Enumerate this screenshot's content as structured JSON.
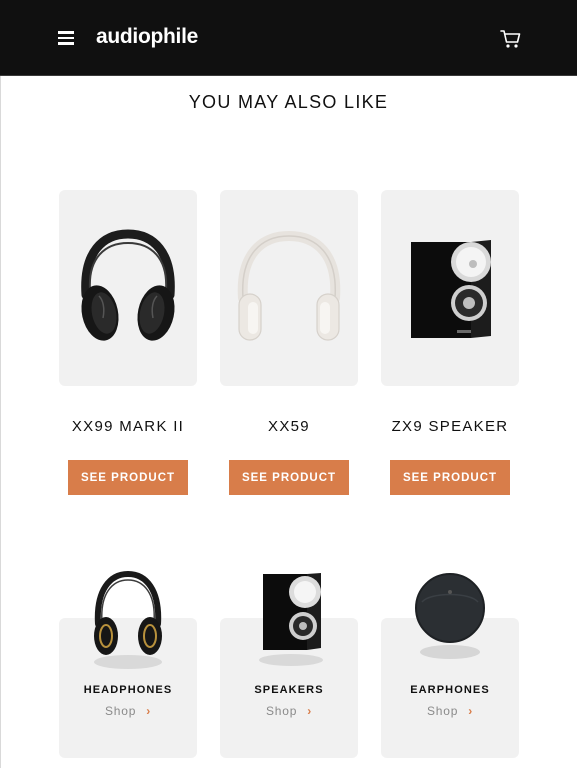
{
  "header": {
    "logo": "audiophile",
    "menu_icon": "hamburger-menu-icon",
    "cart_icon": "cart-icon"
  },
  "section_title": "YOU MAY ALSO LIKE",
  "recommendations": [
    {
      "name": "XX99 MARK II",
      "button": "SEE PRODUCT",
      "icon": "black-headphones-image"
    },
    {
      "name": "XX59",
      "button": "SEE PRODUCT",
      "icon": "white-headphones-image"
    },
    {
      "name": "ZX9 SPEAKER",
      "button": "SEE PRODUCT",
      "icon": "speaker-image"
    }
  ],
  "categories": [
    {
      "name": "HEADPHONES",
      "link": "Shop",
      "arrow": "›",
      "icon": "headphones-image"
    },
    {
      "name": "SPEAKERS",
      "link": "Shop",
      "arrow": "›",
      "icon": "speaker-image"
    },
    {
      "name": "EARPHONES",
      "link": "Shop",
      "arrow": "›",
      "icon": "earphones-case-image"
    }
  ],
  "colors": {
    "header_bg": "#101010",
    "accent": "#d87d4a",
    "card_bg": "#f1f1f1",
    "text": "#101010",
    "muted": "#8a8a8a"
  }
}
